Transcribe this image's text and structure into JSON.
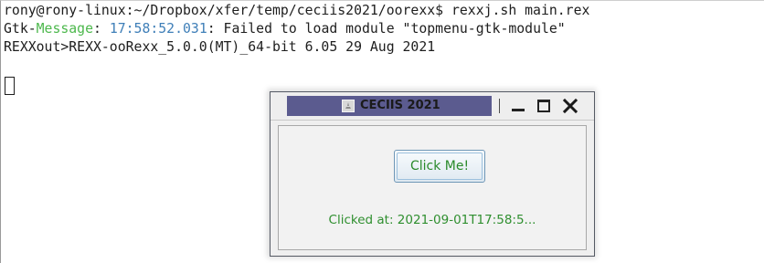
{
  "terminal": {
    "prompt_line": "rony@rony-linux:~/Dropbox/xfer/temp/ceciis2021/oorexx$ rexxj.sh main.rex",
    "gtk_prefix": "Gtk-",
    "gtk_message": "Message",
    "gtk_colon": ": ",
    "gtk_time": "17:58:52.031",
    "gtk_rest": ": Failed to load module \"topmenu-gtk-module\"",
    "rexx_line": "REXXout>REXX-ooRexx_5.0.0(MT)_64-bit 6.05 29 Aug 2021",
    "colors": {
      "text": "#1e1e1e",
      "gtk_message": "#4cb84c",
      "gtk_time": "#3f7fb8"
    }
  },
  "dialog": {
    "title": "CECIIS 2021",
    "title_icon": "java-app-icon",
    "title_bar_color": "#5b5b8f",
    "controls": [
      "minimize-icon",
      "maximize-icon",
      "close-icon"
    ],
    "button_label": "Click Me!",
    "status": "Clicked at: 2021-09-01T17:58:5...",
    "text_color": "#2f8f2f"
  }
}
